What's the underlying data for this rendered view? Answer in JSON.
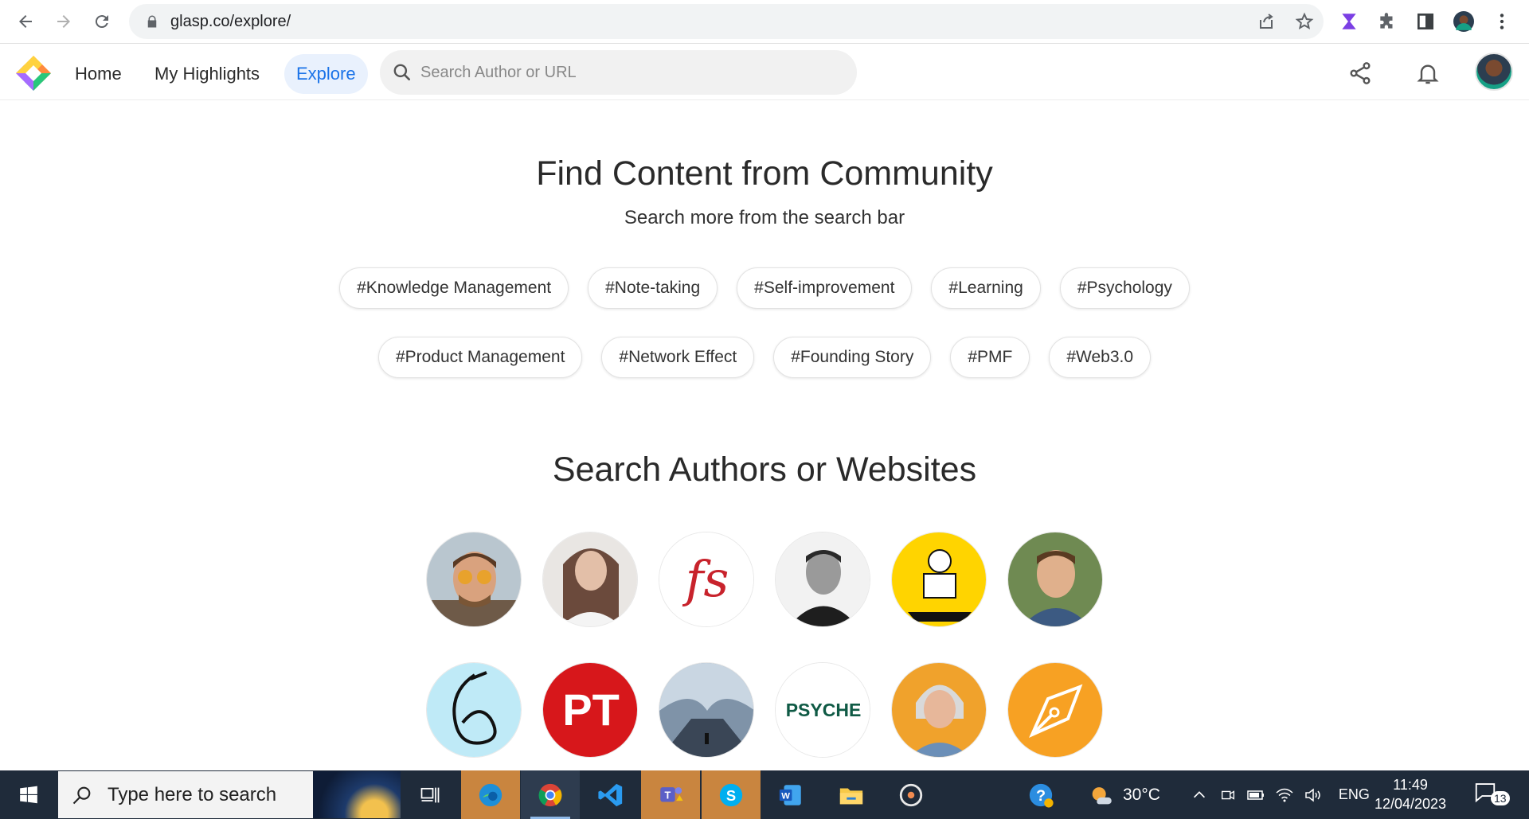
{
  "browser": {
    "url": "glasp.co/explore/",
    "icons": [
      "back-arrow-icon",
      "forward-arrow-icon",
      "reload-icon",
      "lock-icon",
      "share-icon",
      "star-icon",
      "extension-icon",
      "puzzle-icon",
      "sidebar-icon",
      "profile-avatar",
      "kebab-menu-icon"
    ]
  },
  "header": {
    "nav": [
      {
        "label": "Home",
        "active": false
      },
      {
        "label": "My Highlights",
        "active": false
      },
      {
        "label": "Explore",
        "active": true
      }
    ],
    "search_placeholder": "Search Author or URL",
    "accent": "#1a73e8"
  },
  "community": {
    "title": "Find Content from Community",
    "subtitle": "Search more from the search bar",
    "tags_row1": [
      "#Knowledge Management",
      "#Note-taking",
      "#Self-improvement",
      "#Learning",
      "#Psychology"
    ],
    "tags_row2": [
      "#Product Management",
      "#Network Effect",
      "#Founding Story",
      "#PMF",
      "#Web3.0"
    ]
  },
  "authors": {
    "title": "Search Authors or Websites",
    "row1": [
      "author-sunglasses-man",
      "author-young-woman",
      "farnam-street-logo",
      "author-bw-portrait",
      "author-illustration-yellow",
      "author-smiling-man"
    ],
    "row2": [
      "author-script-e-logo",
      "pt-logo",
      "author-glacier-cave",
      "psyche-logo",
      "author-gray-hair-woman",
      "author-pen-nib-logo"
    ],
    "fs_text": "fs",
    "pt_text": "PT",
    "psyche_text": "PSYCHE"
  },
  "taskbar": {
    "search_placeholder": "Type here to search",
    "weather": "30°C",
    "language": "ENG",
    "time": "11:49",
    "date": "12/04/2023",
    "notifications": "13"
  }
}
